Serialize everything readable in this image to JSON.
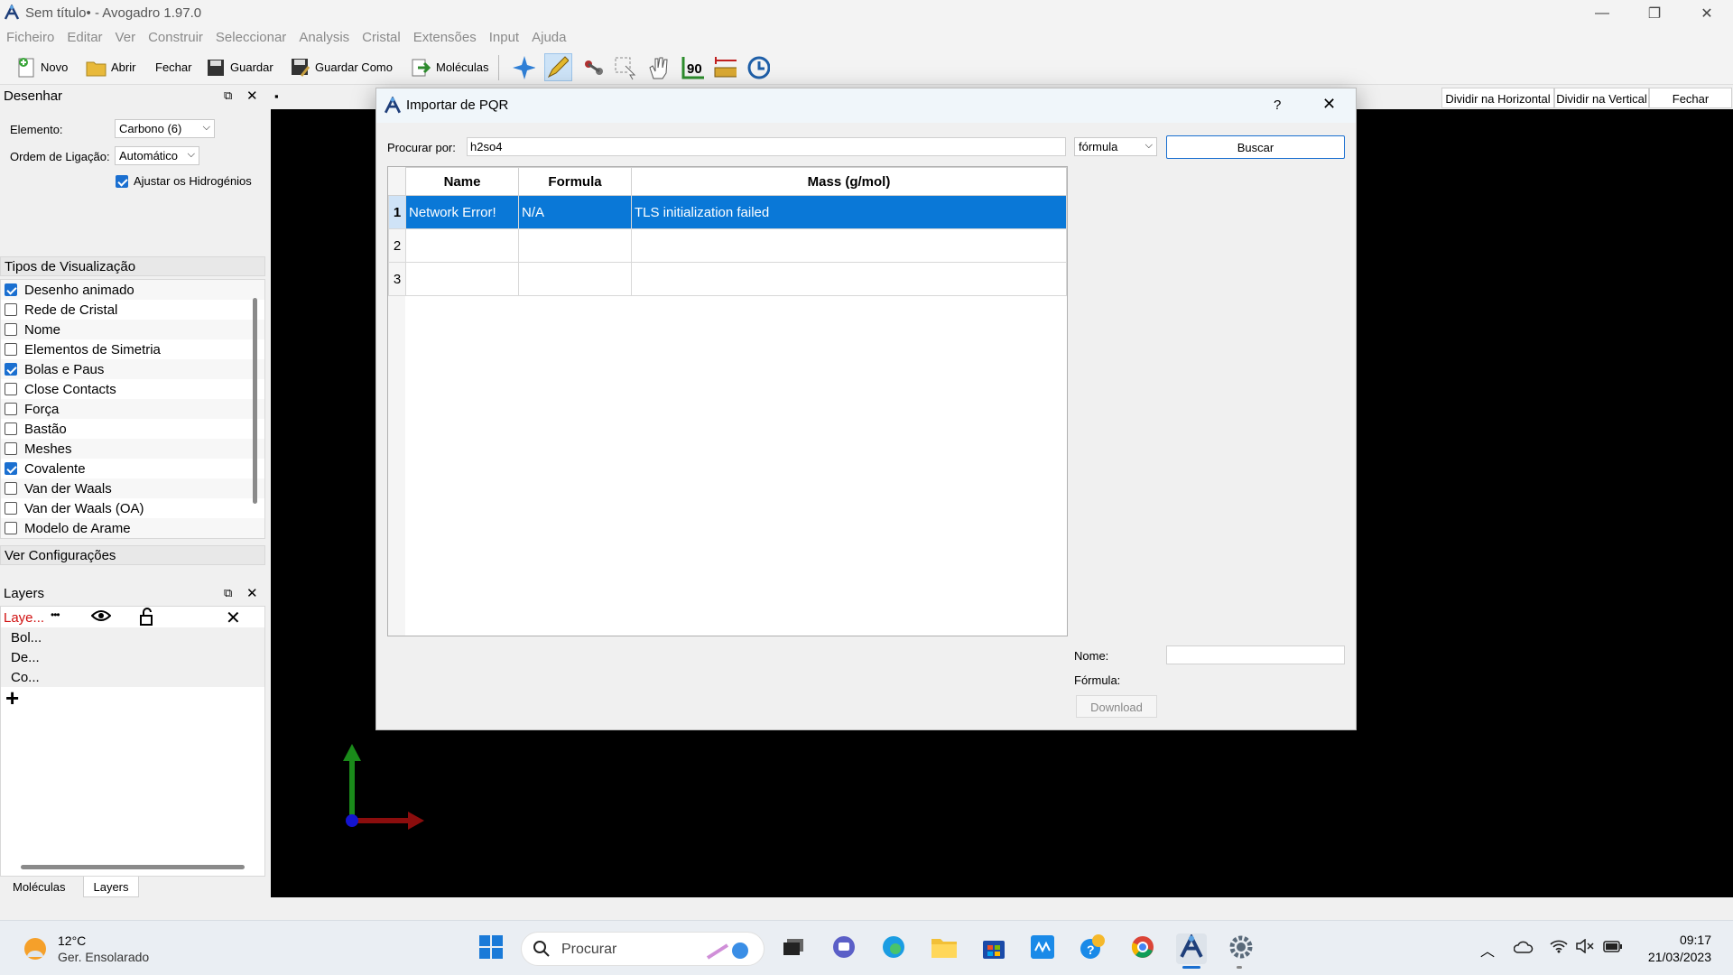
{
  "window": {
    "title": "Sem título• - Avogadro 1.97.0",
    "controls": [
      "minimize-icon",
      "restore-icon",
      "close-icon"
    ]
  },
  "menu": [
    "Ficheiro",
    "Editar",
    "Ver",
    "Construir",
    "Seleccionar",
    "Analysis",
    "Cristal",
    "Extensões",
    "Input",
    "Ajuda"
  ],
  "toolbar": {
    "novo": "Novo",
    "abrir": "Abrir",
    "fechar": "Fechar",
    "guardar": "Guardar",
    "guardar_como": "Guardar Como",
    "moleculas": "Moléculas",
    "tool_icons": [
      "navigate-icon",
      "draw-pencil-icon",
      "bond-centric-icon",
      "select-icon",
      "manipulate-hand-icon",
      "measure-angle-icon",
      "ruler-icon",
      "playback-icon"
    ]
  },
  "draw_panel": {
    "title": "Desenhar",
    "element_label": "Elemento:",
    "element_value": "Carbono (6)",
    "bond_label": "Ordem de Ligação:",
    "bond_value": "Automático",
    "adjust_h": "Ajustar os Hidrogénios"
  },
  "view_types": {
    "title": "Tipos de Visualização",
    "items": [
      {
        "label": "Desenho animado",
        "checked": true
      },
      {
        "label": "Rede de Cristal",
        "checked": false
      },
      {
        "label": "Nome",
        "checked": false
      },
      {
        "label": "Elementos de Simetria",
        "checked": false
      },
      {
        "label": "Bolas e Paus",
        "checked": true
      },
      {
        "label": "Close Contacts",
        "checked": false
      },
      {
        "label": "Força",
        "checked": false
      },
      {
        "label": "Bastão",
        "checked": false
      },
      {
        "label": "Meshes",
        "checked": false
      },
      {
        "label": "Covalente",
        "checked": true
      },
      {
        "label": "Van der Waals",
        "checked": false
      },
      {
        "label": "Van der Waals (OA)",
        "checked": false
      },
      {
        "label": "Modelo de Arame",
        "checked": false
      }
    ]
  },
  "ver_config": "Ver Configurações",
  "layers": {
    "title": "Layers",
    "active": "Laye...",
    "more": "•••",
    "items": [
      "Bol...",
      "De...",
      "Co..."
    ],
    "add": "+"
  },
  "bottom_tabs": [
    "Moléculas",
    "Layers"
  ],
  "view_buttons": {
    "split_h": "Dividir na Horizontal",
    "split_v": "Dividir na Vertical",
    "close": "Fechar"
  },
  "dialog": {
    "title": "Importar de PQR",
    "help": "?",
    "search_label": "Procurar por:",
    "search_value": "h2so4",
    "type_value": "fórmula",
    "search_button": "Buscar",
    "columns": [
      "Name",
      "Formula",
      "Mass (g/mol)"
    ],
    "rows": [
      {
        "n": "1",
        "name": "Network Error!",
        "formula": "N/A",
        "mass": "TLS initialization failed"
      },
      {
        "n": "2",
        "name": "",
        "formula": "",
        "mass": ""
      },
      {
        "n": "3",
        "name": "",
        "formula": "",
        "mass": ""
      }
    ],
    "nome_label": "Nome:",
    "formula_label": "Fórmula:",
    "download": "Download"
  },
  "taskbar": {
    "temp": "12°C",
    "weather": "Ger. Ensolarado",
    "search": "Procurar",
    "time": "09:17",
    "date": "21/03/2023"
  },
  "colors": {
    "accent": "#0a78d7",
    "viewport": "#000000",
    "axis_y": "#1a8a1a",
    "axis_x": "#8b0d0d"
  }
}
